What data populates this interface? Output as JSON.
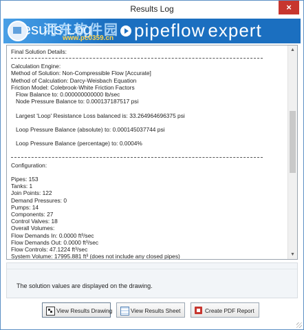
{
  "window": {
    "title": "Results Log",
    "close_glyph": "×"
  },
  "banner": {
    "title": "Results Log",
    "watermark_name": "河东软件园",
    "watermark_url": "www.pc0359.cn",
    "brand_pipe": "pipeflow",
    "brand_expert": "expert"
  },
  "log": {
    "lines": [
      "Final Solution Details:",
      "---",
      "Calculation Engine:",
      "Method of Solution: Non-Compressible Flow [Accurate]",
      "Method of Calculation: Darcy-Weisbach Equation",
      "Friction Model: Colebrook-White Friction Factors",
      "   Flow Balance to: 0.000000000000 lb/sec",
      "   Node Pressure Balance to: 0.000137187517 psi",
      "",
      "   Largest 'Loop' Resistance Loss balanced is: 33.264964696375 psi",
      "",
      "   Loop Pressure Balance (absolute) to: 0.000145037744 psi",
      "",
      "   Loop Pressure Balance (percentage) to: 0.0004%",
      "",
      "---",
      "Configuration:",
      "",
      "Pipes: 153",
      "Tanks: 1",
      "Join Points: 122",
      "Demand Pressures: 0",
      "Pumps: 14",
      "Components: 27",
      "Control Valves: 18",
      "Overall Volumes:",
      "Flow Demands In: 0.0000 ft³/sec",
      "Flow Demands Out: 0.0000 ft³/sec",
      "Flow Controls: 47.1224 ft³/sec",
      "System Volume: 17995.881 ft³ (does not include any closed pipes)"
    ],
    "scroll_up_glyph": "▲",
    "scroll_down_glyph": "▼"
  },
  "info": {
    "message": "The solution values are displayed on the drawing."
  },
  "buttons": {
    "view_drawing": "View Results Drawing",
    "view_sheet": "View Results Sheet",
    "create_pdf": "Create PDF Report"
  },
  "colors": {
    "banner": "#1b6fc0",
    "close": "#c7362f",
    "window_border": "#5b8fc4"
  }
}
